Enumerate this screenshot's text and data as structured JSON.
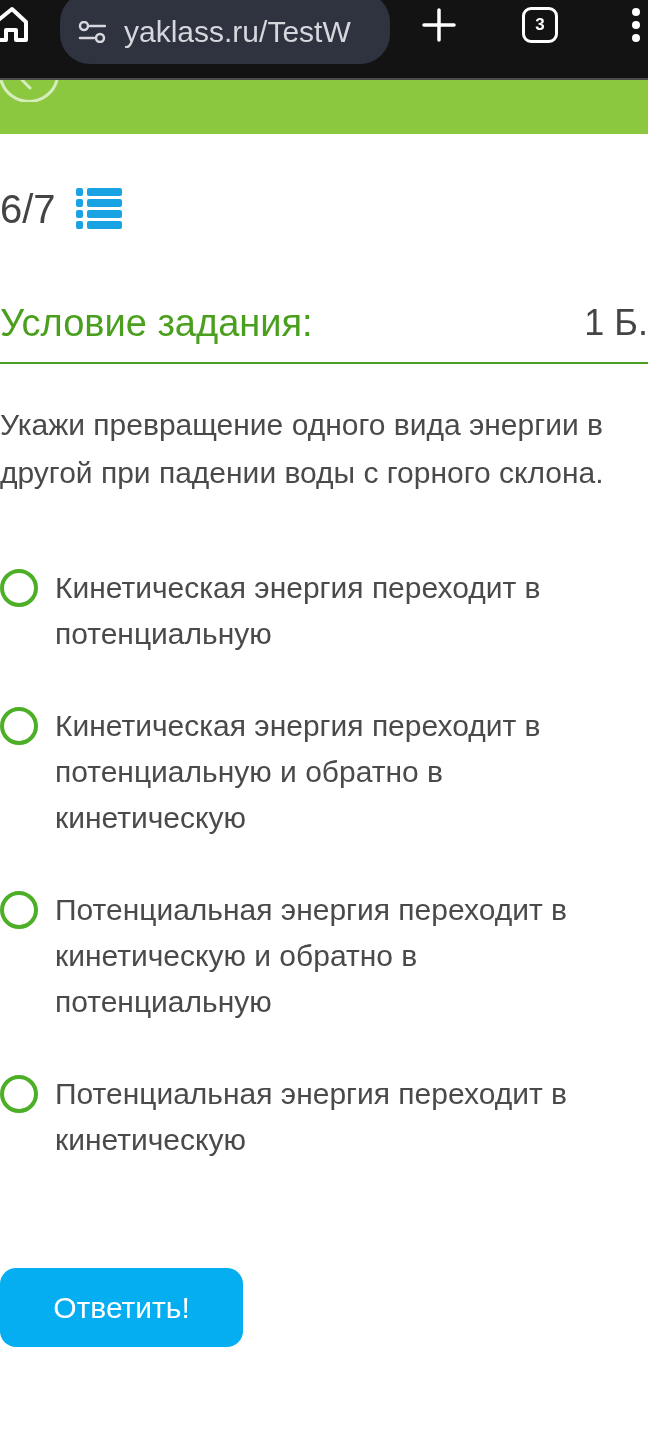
{
  "browser": {
    "url": "yaklass.ru/TestW",
    "tab_count": "3"
  },
  "progress": {
    "counter": "6/7"
  },
  "task": {
    "heading": "Условие задания:",
    "points": "1 Б.",
    "question": "Укажи превращение одного вида энергии в другой при падении воды с горного склона.",
    "options": [
      {
        "text": "Кинетическая энергия переходит в потенциальную",
        "selected": false
      },
      {
        "text": "Кинетическая энергия переходит в потенциальную и обратно в кинетическую",
        "selected": false
      },
      {
        "text": "Потенциальная энергия переходит в кинетическую и обратно в потенциальную",
        "selected": false
      },
      {
        "text": "Потенциальная энергия переходит в кинетическую",
        "selected": false
      }
    ],
    "submit_button": "Ответить!"
  }
}
